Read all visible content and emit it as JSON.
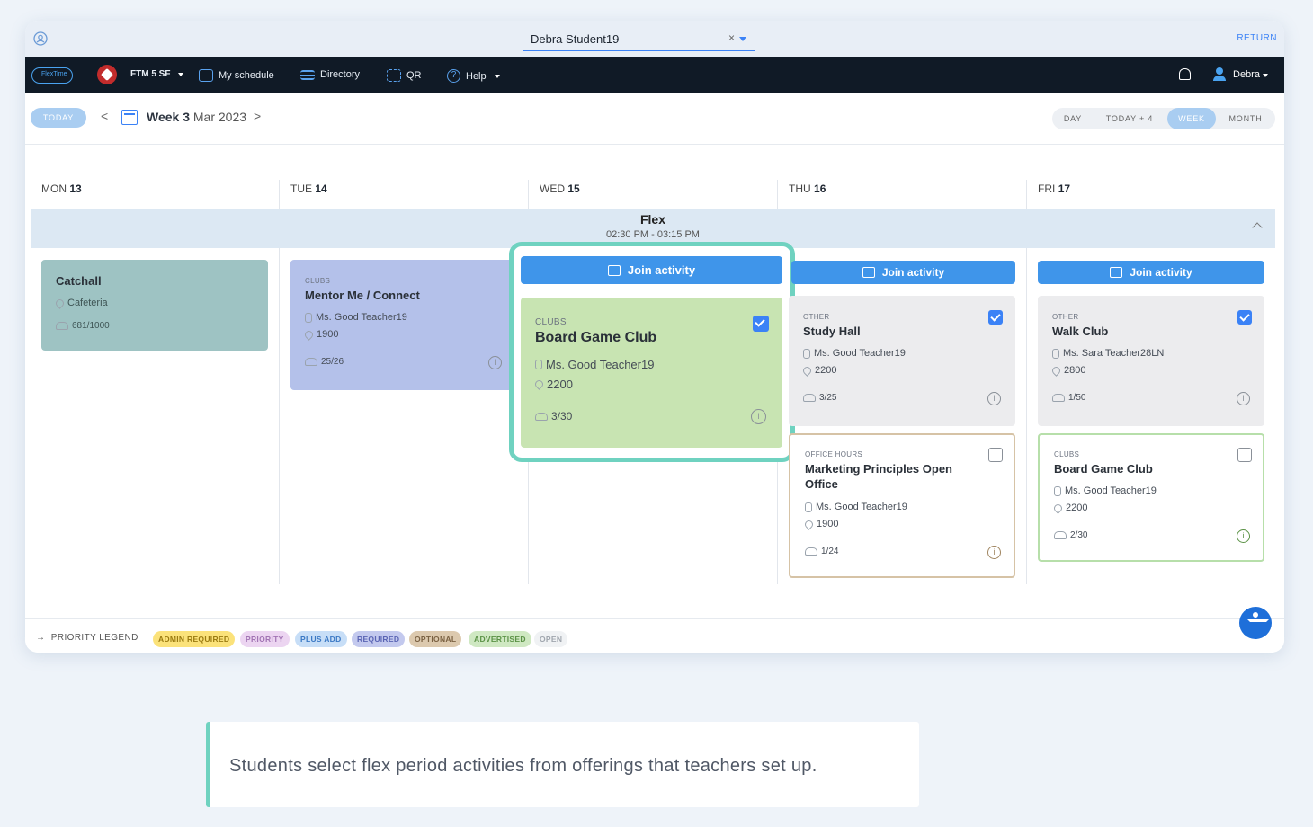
{
  "topbar": {
    "student_name": "Debra Student19",
    "clear_symbol": "×",
    "return_label": "RETURN"
  },
  "nav": {
    "logo_text": "FlexTime Manager",
    "school": "FTM 5 SF",
    "my_schedule": "My schedule",
    "directory": "Directory",
    "qr": "QR",
    "help": "Help",
    "user": "Debra"
  },
  "toolbar": {
    "today": "TODAY",
    "prev": "<",
    "next": ">",
    "week_bold": "Week 3",
    "week_rest": "Mar 2023",
    "views": [
      "DAY",
      "TODAY + 4",
      "WEEK",
      "MONTH"
    ],
    "active_view": "WEEK"
  },
  "days": [
    {
      "dow": "MON",
      "num": "13"
    },
    {
      "dow": "TUE",
      "num": "14"
    },
    {
      "dow": "WED",
      "num": "15"
    },
    {
      "dow": "THU",
      "num": "16"
    },
    {
      "dow": "FRI",
      "num": "17"
    }
  ],
  "flex": {
    "title": "Flex",
    "time": "02:30 PM - 03:15 PM"
  },
  "join_label": "Join activity",
  "cards": {
    "mon": {
      "name": "Catchall",
      "room": "Cafeteria",
      "count": "681/1000"
    },
    "tue": {
      "cat": "CLUBS",
      "name": "Mentor Me / Connect",
      "teacher": "Ms. Good Teacher19",
      "room": "1900",
      "count": "25/26"
    },
    "wed": {
      "cat": "CLUBS",
      "name": "Board Game Club",
      "teacher": "Ms. Good Teacher19",
      "room": "2200",
      "count": "3/30"
    },
    "thu1": {
      "cat": "OTHER",
      "name": "Study Hall",
      "teacher": "Ms. Good Teacher19",
      "room": "2200",
      "count": "3/25"
    },
    "thu2": {
      "cat": "OFFICE HOURS",
      "name": "Marketing Principles Open Office",
      "teacher": "Ms. Good Teacher19",
      "room": "1900",
      "count": "1/24"
    },
    "fri1": {
      "cat": "OTHER",
      "name": "Walk Club",
      "teacher": "Ms. Sara Teacher28LN",
      "room": "2800",
      "count": "1/50"
    },
    "fri2": {
      "cat": "CLUBS",
      "name": "Board Game Club",
      "teacher": "Ms. Good Teacher19",
      "room": "2200",
      "count": "2/30"
    }
  },
  "legend": {
    "label": "PRIORITY LEGEND",
    "items": [
      {
        "text": "ADMIN REQUIRED",
        "bg": "#fbe27a",
        "fg": "#9a7a10"
      },
      {
        "text": "PRIORITY",
        "bg": "#ecd5f1",
        "fg": "#a274b4"
      },
      {
        "text": "PLUS ADD",
        "bg": "#c7def7",
        "fg": "#3a78c4"
      },
      {
        "text": "REQUIRED",
        "bg": "#c3c9ee",
        "fg": "#5a64b4"
      },
      {
        "text": "OPTIONAL",
        "bg": "#dcc9ae",
        "fg": "#7a6142"
      },
      {
        "text": "ADVERTISED",
        "bg": "#cfe8c2",
        "fg": "#5b9246"
      },
      {
        "text": "OPEN",
        "bg": "#f0f2f4",
        "fg": "#a0a6ae"
      }
    ]
  },
  "colors": {
    "accent": "#3f95ea",
    "highlight": "#6fd2c0",
    "catchall": "#9ec3c3",
    "required": "#b4c1ea",
    "advertised": "#c8e4b2",
    "optional_border": "#d6c3a6",
    "advertised_border": "#b7dfaa"
  },
  "caption": "Students select flex period activities from offerings that teachers set up."
}
